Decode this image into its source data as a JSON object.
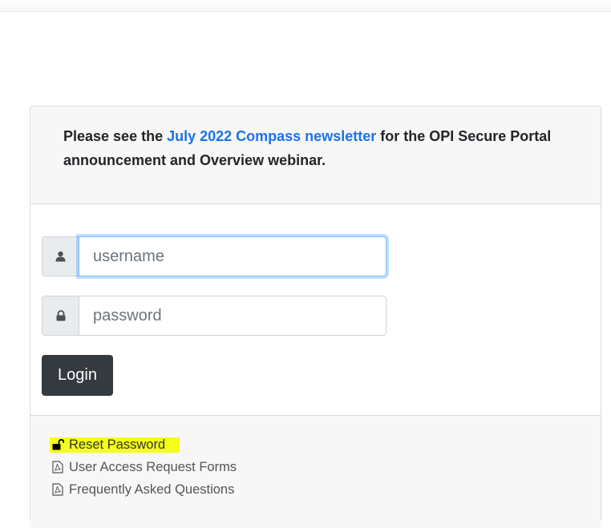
{
  "announcement": {
    "prefix": "Please see the ",
    "link_text": "July 2022 Compass newsletter",
    "suffix": " for the OPI Secure Portal announcement and Overview webinar."
  },
  "login_form": {
    "username_placeholder": "username",
    "password_placeholder": "password",
    "login_label": "Login",
    "username_icon": "user-icon",
    "password_icon": "lock-icon"
  },
  "footer_links": [
    {
      "label": "Reset Password",
      "icon": "unlock-icon",
      "highlighted": true
    },
    {
      "label": "User Access Request Forms",
      "icon": "pdf-file-icon"
    },
    {
      "label": "Frequently Asked Questions",
      "icon": "pdf-file-icon"
    }
  ],
  "colors": {
    "link": "#1a73e8",
    "button": "#343a40",
    "highlight": "#f4ff1a",
    "panel": "#f7f7f7"
  }
}
